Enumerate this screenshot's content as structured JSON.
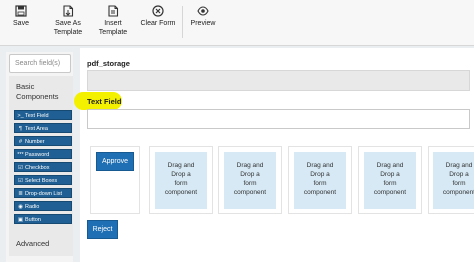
{
  "toolbar": {
    "save": "Save",
    "save_as_template": [
      "Save As",
      "Template"
    ],
    "insert_template": [
      "Insert",
      "Template"
    ],
    "clear_form": "Clear Form",
    "preview": "Preview"
  },
  "sidebar": {
    "search_placeholder": "Search field(s)",
    "basic_title": [
      "Basic",
      "Components"
    ],
    "components": [
      {
        "icon": ">_",
        "label": "Text Field"
      },
      {
        "icon": "¶",
        "label": "Text Area"
      },
      {
        "icon": "#",
        "label": "Number"
      },
      {
        "icon": "***",
        "label": "Password"
      },
      {
        "icon": "☑",
        "label": "Checkbox"
      },
      {
        "icon": "☑",
        "label": "Select Boxes"
      },
      {
        "icon": "≣",
        "label": "Drop-down List"
      },
      {
        "icon": "◉",
        "label": "Radio"
      },
      {
        "icon": "▣",
        "label": "Button"
      }
    ],
    "advanced_title": "Advanced"
  },
  "form": {
    "pdf_storage_label": "pdf_storage",
    "text_field_label": "Text Field",
    "approve_label": "Approve",
    "drop_placeholder": [
      "Drag and",
      "Drop a",
      "form",
      "component"
    ],
    "reject_label": "Reject"
  },
  "colors": {
    "accent": "#1f6fb4",
    "drop_zone": "#d6e9f5",
    "highlight": "#f3f000"
  }
}
